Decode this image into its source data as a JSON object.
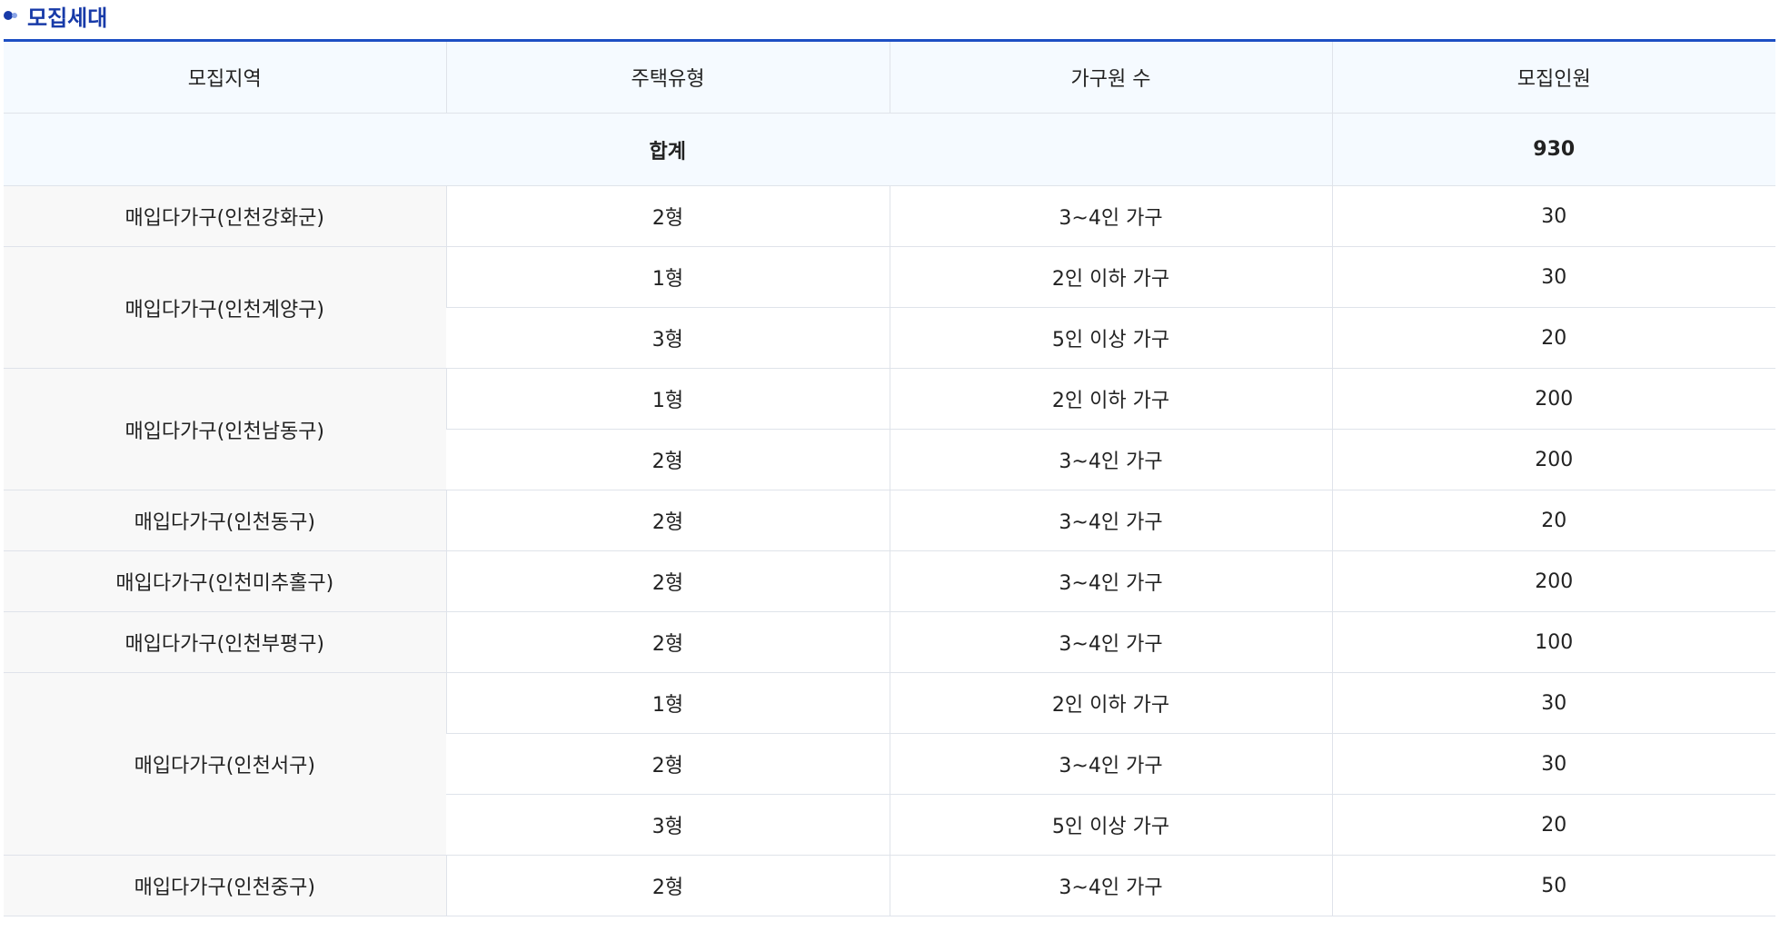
{
  "section": {
    "title": "모집세대"
  },
  "table": {
    "headers": [
      "모집지역",
      "주택유형",
      "가구원 수",
      "모집인원"
    ],
    "total": {
      "label": "합계",
      "count": "930"
    },
    "rows": [
      {
        "region": "매입다가구(인천강화군)",
        "type": "2형",
        "household": "3~4인 가구",
        "count": "30"
      },
      {
        "region": "매입다가구(인천계양구)",
        "type": "1형",
        "household": "2인 이하 가구",
        "count": "30"
      },
      {
        "region": "",
        "type": "3형",
        "household": "5인 이상 가구",
        "count": "20"
      },
      {
        "region": "매입다가구(인천남동구)",
        "type": "1형",
        "household": "2인 이하 가구",
        "count": "200"
      },
      {
        "region": "",
        "type": "2형",
        "household": "3~4인 가구",
        "count": "200"
      },
      {
        "region": "매입다가구(인천동구)",
        "type": "2형",
        "household": "3~4인 가구",
        "count": "20"
      },
      {
        "region": "매입다가구(인천미추홀구)",
        "type": "2형",
        "household": "3~4인 가구",
        "count": "200"
      },
      {
        "region": "매입다가구(인천부평구)",
        "type": "2형",
        "household": "3~4인 가구",
        "count": "100"
      },
      {
        "region": "매입다가구(인천서구)",
        "type": "1형",
        "household": "2인 이하 가구",
        "count": "30"
      },
      {
        "region": "",
        "type": "2형",
        "household": "3~4인 가구",
        "count": "30"
      },
      {
        "region": "",
        "type": "3형",
        "household": "5인 이상 가구",
        "count": "20"
      },
      {
        "region": "매입다가구(인천중구)",
        "type": "2형",
        "household": "3~4인 가구",
        "count": "50"
      }
    ]
  },
  "colors": {
    "title": "#173aa8",
    "top_border": "#1d4fc4",
    "header_bg": "#f5faff",
    "region_bg": "#f8f8f8"
  },
  "icons": {
    "title_bullet": "bullet-dot-icon"
  }
}
